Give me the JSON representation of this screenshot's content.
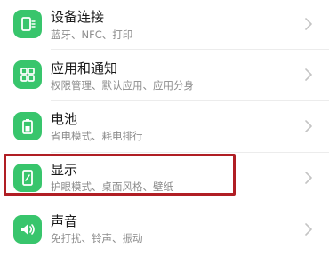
{
  "accent_color": "#38c56c",
  "highlight_color": "#b01e24",
  "settings": {
    "items": [
      {
        "icon": "device-connection-icon",
        "title": "设备连接",
        "subtitle": "蓝牙、NFC、打印"
      },
      {
        "icon": "apps-notifications-icon",
        "title": "应用和通知",
        "subtitle": "权限管理、默认应用、应用分身"
      },
      {
        "icon": "battery-icon",
        "title": "电池",
        "subtitle": "省电模式、耗电排行"
      },
      {
        "icon": "display-icon",
        "title": "显示",
        "subtitle": "护眼模式、桌面风格、壁纸"
      },
      {
        "icon": "sound-icon",
        "title": "声音",
        "subtitle": "免打扰、铃声、振动"
      }
    ]
  }
}
